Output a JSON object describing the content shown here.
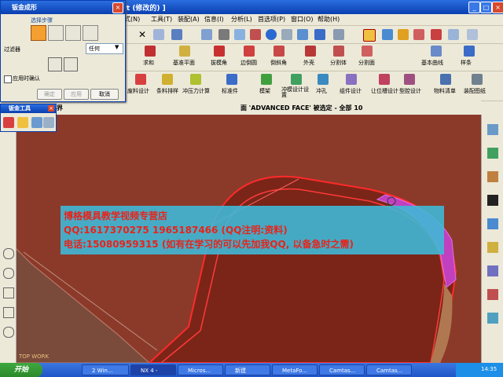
{
  "window": {
    "title": "prt  (修改的)  ]"
  },
  "menubar": {
    "items": [
      "式(N)",
      "工具(T)",
      "装配(A)",
      "信息(I)",
      "分析(L)",
      "首选项(P)",
      "窗口(O)",
      "帮助(H)"
    ]
  },
  "toolbar2": {
    "labels": [
      "求和",
      "基准平面",
      "拔模角",
      "边倒圆",
      "倒斜角",
      "外壳",
      "分割体",
      "分割面",
      "基本曲线",
      "样条"
    ]
  },
  "toolbar3": {
    "labels": [
      "废料设计",
      "条料排样",
      "冲压力计算",
      "标准件",
      "模架",
      "冲模设计设置",
      "冲孔",
      "组件设计",
      "让位槽设计",
      "型腔设计",
      "物料清单",
      "装配图纸"
    ]
  },
  "dialog": {
    "title": "钣金成形",
    "select_step": "选择步骤",
    "filter_label": "过滤器",
    "filter_value": "任何",
    "apply_confirm": "应用时确认",
    "ok": "确定",
    "apply": "应用",
    "cancel": "取消"
  },
  "sheetmetal_toolbar": {
    "title": "钣金工具"
  },
  "viewport": {
    "left_title": "指",
    "border_label": "界",
    "status": "面 'ADVANCED FACE' 被选定 - 全部 10",
    "view_label": "TOP WORK"
  },
  "watermark": {
    "line1": "博格模具教学视频专营店",
    "line2": "QQ:1617370275  1965187466 (QQ注明:资料)",
    "line3": "电话:15080959315 (如有在学习的可以先加我QQ, 以备急时之需)"
  },
  "taskbar": {
    "start": "开始",
    "tasks": [
      "2 Win...",
      "NX 4 -",
      "Micros...",
      "新建",
      "MetaFo...",
      "Camtas...",
      "Camtas..."
    ],
    "clock": "14:35"
  },
  "colors": {
    "viewport_bg": "#8b3a2a",
    "part_dark": "#7a2518",
    "edge_red": "#ff2a2a",
    "highlight": "#c040c0",
    "watermark_bg": "#40b8d6",
    "watermark_text": "#e8231a"
  }
}
